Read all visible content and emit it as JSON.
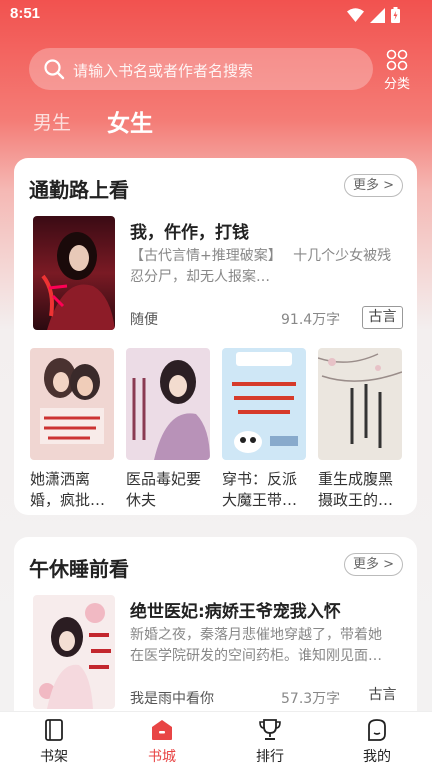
{
  "status_bar": {
    "time": "8:51"
  },
  "search": {
    "placeholder": "请输入书名或者作者名搜索"
  },
  "category": {
    "label": "分类"
  },
  "gender_tabs": {
    "male": "男生",
    "female": "女生",
    "selected": "女生"
  },
  "section1": {
    "title": "通勤路上看",
    "more": "更多 >",
    "featured": {
      "title": "我，仵作，打钱",
      "description": "【古代言情+推理破案】　 十几个少女被残忍分尸，却无人报案…",
      "author": "随便",
      "words": "91.4万字",
      "tag": "古言"
    },
    "books": [
      {
        "title": "她潇洒离婚，疯批…"
      },
      {
        "title": "医品毒妃要休夫"
      },
      {
        "title": "穿书：反派大魔王带…"
      },
      {
        "title": "重生成腹黑摄政王的…"
      }
    ]
  },
  "section2": {
    "title": "午休睡前看",
    "more": "更多 >",
    "featured": {
      "title": "绝世医妃:病娇王爷宠我入怀",
      "description": "新婚之夜，秦落月悲催地穿越了，带着她在医学院研发的空间药柜。谁知刚见面…",
      "author": "我是雨中看你",
      "words": "57.3万字",
      "tag": "古言"
    }
  },
  "bottom_nav": [
    {
      "label": "书架",
      "icon": "bookshelf-icon",
      "active": false
    },
    {
      "label": "书城",
      "icon": "bookstore-icon",
      "active": true
    },
    {
      "label": "排行",
      "icon": "trophy-icon",
      "active": false
    },
    {
      "label": "我的",
      "icon": "profile-icon",
      "active": false
    }
  ],
  "colors": {
    "accent": "#e84545",
    "header": "#f2524f"
  }
}
